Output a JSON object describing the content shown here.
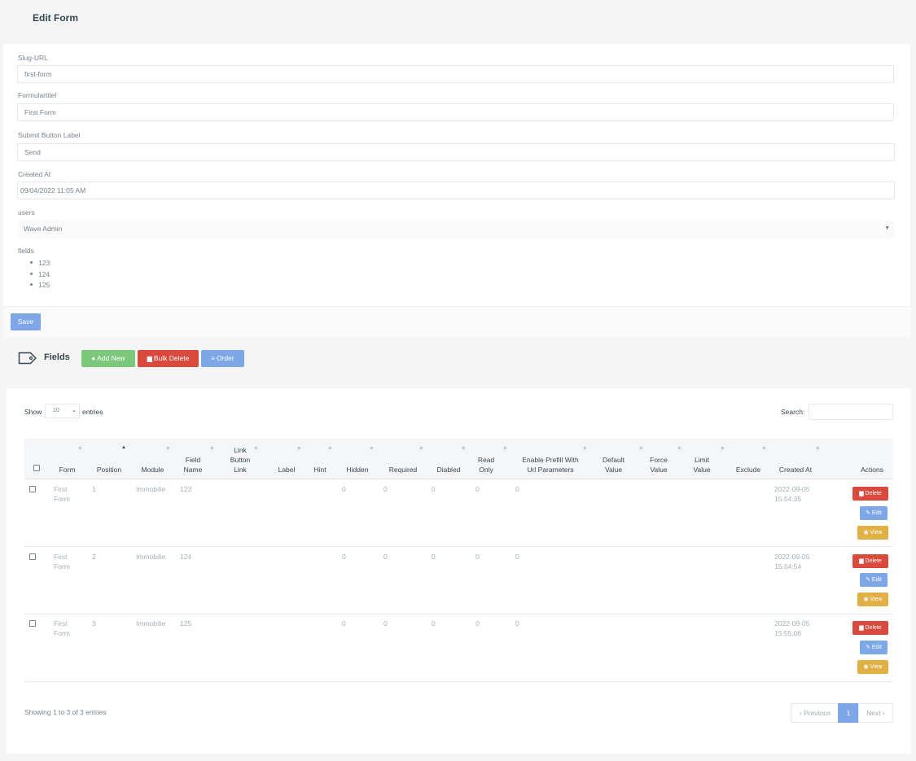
{
  "page": {
    "title": "Edit Form"
  },
  "form": {
    "slug_label": "Slug-URL",
    "slug_value": "first-form",
    "title_label": "Formulartitel",
    "title_value": "First Form",
    "submit_label": "Submit Button Label",
    "submit_value": "Send",
    "created_label": "Created At",
    "created_value": "09/04/2022 11:05 AM",
    "users_label": "users",
    "users_value": "Wave Admin",
    "fields_label": "fields",
    "fields": [
      "123",
      "124",
      "125"
    ],
    "save_label": "Save"
  },
  "fields_section": {
    "title": "Fields",
    "add_label": "Add New",
    "bulk_label": "Bulk Delete",
    "order_label": "Order"
  },
  "table": {
    "show_label": "Show",
    "entries_value": "10",
    "entries_label": "entries",
    "search_label": "Search:",
    "columns": [
      "Form",
      "Position",
      "Module",
      "Field Name",
      "Link Button Link",
      "Label",
      "Hint",
      "Hidden",
      "Required",
      "Diabled",
      "Read Only",
      "Enable Prefill With Url Parameters",
      "Default Value",
      "Force Value",
      "Limit Value",
      "Exclude",
      "Created At",
      "Actions"
    ],
    "rows": [
      {
        "form": "First Form",
        "position": "1",
        "module": "Immobilie",
        "field_name": "123",
        "hidden": "0",
        "required": "0",
        "disabled": "0",
        "read_only": "0",
        "prefill": "0",
        "created_date": "2022-09-05",
        "created_time": "15:54:35"
      },
      {
        "form": "First Form",
        "position": "2",
        "module": "Immobilie",
        "field_name": "124",
        "hidden": "0",
        "required": "0",
        "disabled": "0",
        "read_only": "0",
        "prefill": "0",
        "created_date": "2022-09-05",
        "created_time": "15:54:54"
      },
      {
        "form": "First Form",
        "position": "3",
        "module": "Immobilie",
        "field_name": "125",
        "hidden": "0",
        "required": "0",
        "disabled": "0",
        "read_only": "0",
        "prefill": "0",
        "created_date": "2022-09-05",
        "created_time": "15:55:06"
      }
    ],
    "actions": {
      "delete": "Delete",
      "edit": "Edit",
      "view": "View"
    },
    "info": "Showing 1 to 3 of 3 entries",
    "pager": {
      "previous": "Previous",
      "current": "1",
      "next": "Next"
    }
  },
  "colors": {
    "primary": "#7ea7e8",
    "success": "#7cc87a",
    "danger": "#d9493c",
    "warning": "#e0b045"
  }
}
